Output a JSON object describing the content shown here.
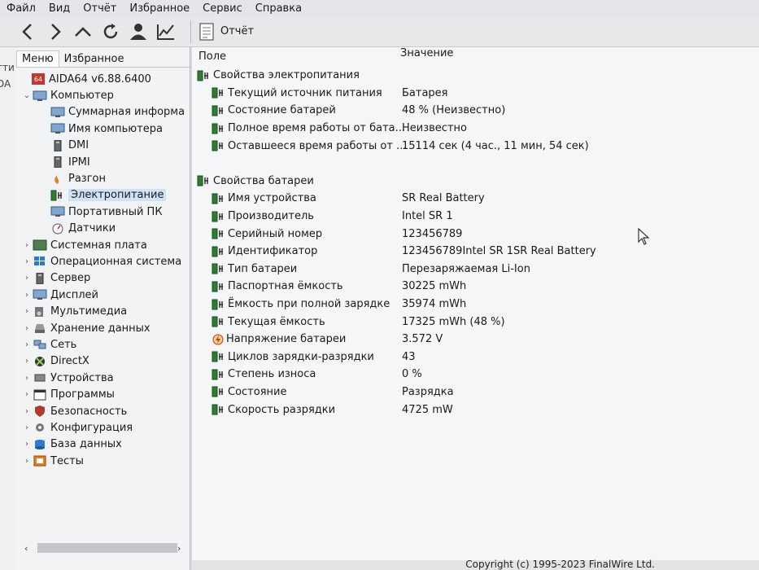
{
  "menubar": [
    "Файл",
    "Вид",
    "Отчёт",
    "Избранное",
    "Сервис",
    "Справка"
  ],
  "toolbar": {
    "report_label": "Отчёт"
  },
  "left_edge": [
    "тти",
    "DA"
  ],
  "left_tabs": [
    "Меню",
    "Избранное"
  ],
  "tree": [
    {
      "label": "AIDA64 v6.88.6400",
      "indent": 0,
      "arrow": "",
      "icon": "aida64-icon"
    },
    {
      "label": "Компьютер",
      "indent": 0,
      "arrow": "⌄",
      "icon": "computer-icon"
    },
    {
      "label": "Суммарная информа",
      "indent": 1,
      "arrow": "",
      "icon": "summary-icon"
    },
    {
      "label": "Имя компьютера",
      "indent": 1,
      "arrow": "",
      "icon": "computer-name-icon"
    },
    {
      "label": "DMI",
      "indent": 1,
      "arrow": "",
      "icon": "dmi-icon"
    },
    {
      "label": "IPMI",
      "indent": 1,
      "arrow": "",
      "icon": "ipmi-icon"
    },
    {
      "label": "Разгон",
      "indent": 1,
      "arrow": "",
      "icon": "overclock-icon"
    },
    {
      "label": "Электропитание",
      "indent": 1,
      "arrow": "",
      "icon": "battery-icon",
      "selected": true
    },
    {
      "label": "Портативный ПК",
      "indent": 1,
      "arrow": "",
      "icon": "laptop-icon"
    },
    {
      "label": "Датчики",
      "indent": 1,
      "arrow": "",
      "icon": "sensor-icon"
    },
    {
      "label": "Системная плата",
      "indent": 0,
      "arrow": "›",
      "icon": "motherboard-icon"
    },
    {
      "label": "Операционная система",
      "indent": 0,
      "arrow": "›",
      "icon": "windows-icon"
    },
    {
      "label": "Сервер",
      "indent": 0,
      "arrow": "›",
      "icon": "server-icon"
    },
    {
      "label": "Дисплей",
      "indent": 0,
      "arrow": "›",
      "icon": "display-icon"
    },
    {
      "label": "Мультимедиа",
      "indent": 0,
      "arrow": "›",
      "icon": "multimedia-icon"
    },
    {
      "label": "Хранение данных",
      "indent": 0,
      "arrow": "›",
      "icon": "storage-icon"
    },
    {
      "label": "Сеть",
      "indent": 0,
      "arrow": "›",
      "icon": "network-icon"
    },
    {
      "label": "DirectX",
      "indent": 0,
      "arrow": "›",
      "icon": "directx-icon"
    },
    {
      "label": "Устройства",
      "indent": 0,
      "arrow": "›",
      "icon": "devices-icon"
    },
    {
      "label": "Программы",
      "indent": 0,
      "arrow": "›",
      "icon": "programs-icon"
    },
    {
      "label": "Безопасность",
      "indent": 0,
      "arrow": "›",
      "icon": "security-icon"
    },
    {
      "label": "Конфигурация",
      "indent": 0,
      "arrow": "›",
      "icon": "config-icon"
    },
    {
      "label": "База данных",
      "indent": 0,
      "arrow": "›",
      "icon": "database-icon"
    },
    {
      "label": "Тесты",
      "indent": 0,
      "arrow": "›",
      "icon": "tests-icon"
    }
  ],
  "columns": {
    "field": "Поле",
    "value": "Значение"
  },
  "rows": [
    {
      "type": "group",
      "field": "Свойства электропитания",
      "value": ""
    },
    {
      "type": "item",
      "field": "Текущий источник питания",
      "value": "Батарея",
      "icon": "battery-icon"
    },
    {
      "type": "item",
      "field": "Состояние батарей",
      "value": "48 % (Неизвестно)",
      "icon": "battery-icon"
    },
    {
      "type": "item",
      "field": "Полное время работы от бата...",
      "value": "Неизвестно",
      "icon": "battery-icon"
    },
    {
      "type": "item",
      "field": "Оставшееся время работы от ...",
      "value": "15114 сек (4 час., 11 мин, 54 сек)",
      "icon": "battery-icon"
    },
    {
      "type": "spacer"
    },
    {
      "type": "group",
      "field": "Свойства батареи",
      "value": ""
    },
    {
      "type": "item",
      "field": "Имя устройства",
      "value": "SR Real Battery",
      "icon": "battery-icon"
    },
    {
      "type": "item",
      "field": "Производитель",
      "value": "Intel SR 1",
      "icon": "battery-icon"
    },
    {
      "type": "item",
      "field": "Серийный номер",
      "value": "123456789",
      "icon": "battery-icon"
    },
    {
      "type": "item",
      "field": "Идентификатор",
      "value": "123456789Intel SR 1SR Real Battery",
      "icon": "battery-icon"
    },
    {
      "type": "item",
      "field": "Тип батареи",
      "value": "Перезаряжаемая Li-Ion",
      "icon": "battery-icon"
    },
    {
      "type": "item",
      "field": "Паспортная ёмкость",
      "value": "30225 mWh",
      "icon": "battery-icon"
    },
    {
      "type": "item",
      "field": "Ёмкость при полной зарядке",
      "value": "35974 mWh",
      "icon": "battery-icon"
    },
    {
      "type": "item",
      "field": "Текущая ёмкость",
      "value": "17325 mWh  (48 %)",
      "icon": "battery-icon"
    },
    {
      "type": "item",
      "field": "Напряжение батареи",
      "value": "3.572 V",
      "icon": "voltage-icon"
    },
    {
      "type": "item",
      "field": "Циклов зарядки-разрядки",
      "value": "43",
      "icon": "battery-icon"
    },
    {
      "type": "item",
      "field": "Степень износа",
      "value": "0 %",
      "icon": "battery-icon"
    },
    {
      "type": "item",
      "field": "Состояние",
      "value": "Разрядка",
      "icon": "battery-icon"
    },
    {
      "type": "item",
      "field": "Скорость разрядки",
      "value": "4725 mW",
      "icon": "battery-icon"
    }
  ],
  "footer": {
    "copyright": "Copyright (c) 1995-2023 FinalWire Ltd."
  },
  "colors": {
    "battery_green": "#2e7d32",
    "selection": "#cfe3f7",
    "voltage_red": "#c0392b"
  }
}
